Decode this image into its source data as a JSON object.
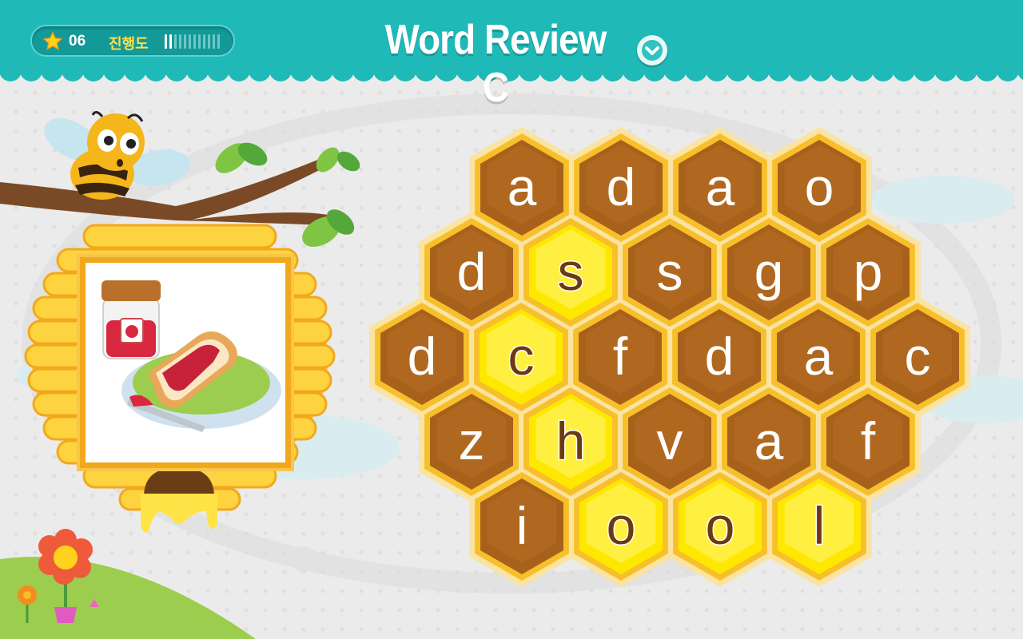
{
  "header": {
    "star_count": "06",
    "progress_label": "진행도",
    "progress_done": 2,
    "progress_total": 12,
    "title": "Word Review C"
  },
  "colors": {
    "teal": "#1fb9b8",
    "honey_dark": "#a8611b",
    "honey_gold": "#f7c02a",
    "selected_yellow": "#ffe800",
    "letter_normal": "#ffffff",
    "letter_selected": "#6b3a12"
  },
  "icons": {
    "star": "star-icon",
    "dropdown": "chevron-down-icon",
    "picture": "jam-toast-image"
  },
  "board": {
    "rows": [
      {
        "cells": [
          {
            "letter": "a",
            "selected": false
          },
          {
            "letter": "d",
            "selected": false
          },
          {
            "letter": "a",
            "selected": false
          },
          {
            "letter": "o",
            "selected": false
          }
        ]
      },
      {
        "cells": [
          {
            "letter": "d",
            "selected": false
          },
          {
            "letter": "s",
            "selected": true
          },
          {
            "letter": "s",
            "selected": false
          },
          {
            "letter": "g",
            "selected": false
          },
          {
            "letter": "p",
            "selected": false
          }
        ]
      },
      {
        "cells": [
          {
            "letter": "d",
            "selected": false
          },
          {
            "letter": "c",
            "selected": true
          },
          {
            "letter": "f",
            "selected": false
          },
          {
            "letter": "d",
            "selected": false
          },
          {
            "letter": "a",
            "selected": false
          },
          {
            "letter": "c",
            "selected": false
          }
        ]
      },
      {
        "cells": [
          {
            "letter": "z",
            "selected": false
          },
          {
            "letter": "h",
            "selected": true
          },
          {
            "letter": "v",
            "selected": false
          },
          {
            "letter": "a",
            "selected": false
          },
          {
            "letter": "f",
            "selected": false
          }
        ]
      },
      {
        "cells": [
          {
            "letter": "i",
            "selected": false
          },
          {
            "letter": "o",
            "selected": true
          },
          {
            "letter": "o",
            "selected": true
          },
          {
            "letter": "l",
            "selected": true
          }
        ]
      }
    ]
  }
}
